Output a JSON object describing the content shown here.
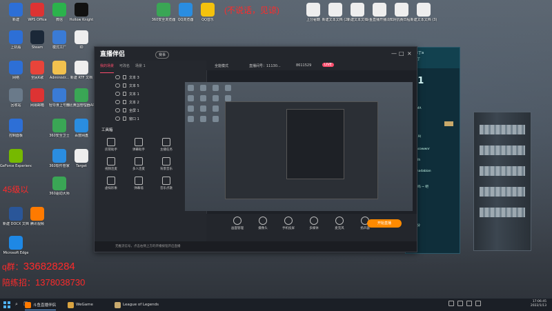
{
  "desktop": {
    "icons": [
      {
        "label": "新建",
        "color": "#2d6fd6"
      },
      {
        "label": "WPS Office",
        "color": "#d33"
      },
      {
        "label": "微信",
        "color": "#2bb24c"
      },
      {
        "label": "Hollow Knight",
        "color": "#111"
      },
      {
        "label": "360安全浏览器",
        "color": "#3aa655"
      },
      {
        "label": "QQ浏览器",
        "color": "#2a8de0"
      },
      {
        "label": "QQ音乐",
        "color": "#f4c20d"
      },
      {
        "label": "上分秘籍",
        "color": "#eeeeee"
      },
      {
        "label": "新建文本文档 (2)",
        "color": "#eeeeee"
      },
      {
        "label": "新建文本文档",
        "color": "#eeeeee"
      },
      {
        "label": "斗鱼直播开播须知",
        "color": "#eeeeee"
      },
      {
        "label": "对抗赛日程",
        "color": "#eeeeee"
      },
      {
        "label": "新建文本文档 (3)",
        "color": "#eeeeee"
      },
      {
        "label": "上机看",
        "color": "#2d6fd6"
      },
      {
        "label": "Steam",
        "color": "#1b2838"
      },
      {
        "label": "模式工厂",
        "color": "#3a7bd5"
      },
      {
        "label": "ID",
        "color": "#eeeeee"
      },
      {
        "label": "网络",
        "color": "#2d6fd6"
      },
      {
        "label": "全民K歌",
        "color": "#e8443a"
      },
      {
        "label": "Administr...",
        "color": "#f2c14e"
      },
      {
        "label": "新建 RTF 文档",
        "color": "#eeeeee"
      },
      {
        "label": "回收站",
        "color": "#6a7a8a"
      },
      {
        "label": "网易邮箱",
        "color": "#d33"
      },
      {
        "label": "轻导身上号器",
        "color": "#3a7bd5"
      },
      {
        "label": "帅比黄国管理器APP",
        "color": "#3aa655"
      },
      {
        "label": "控制面板",
        "color": "#2d6fd6"
      },
      {
        "label": "360安全卫士",
        "color": "#3aa655"
      },
      {
        "label": "百度网盘",
        "color": "#2a8de0"
      },
      {
        "label": "GeForce Experience",
        "color": "#76b900"
      },
      {
        "label": "360软件管家",
        "color": "#2a8de0"
      },
      {
        "label": "Target",
        "color": "#eeeeee"
      },
      {
        "label": "新建 DOCX 文档",
        "color": "#2a5699"
      },
      {
        "label": "腾讯视频",
        "color": "#ff7a00"
      },
      {
        "label": "Microsoft Edge",
        "color": "#1e88e5"
      },
      {
        "label": "360驱动大师",
        "color": "#3aa655"
      }
    ],
    "overlay_red_top": "(不说话，见谅)",
    "overlay_red_left": "45级以",
    "overlay_q_label": "q群：",
    "overlay_q_number": "336828284",
    "overlay_recruit_label": "陪练招：",
    "overlay_recruit_number": "1378038730"
  },
  "obs": {
    "app_name": "直播伴侣",
    "badge": "赛事",
    "tabs": [
      "我的场景",
      "可改名",
      "场景 1"
    ],
    "scenes": [
      "文本 3",
      "文本 5",
      "文本 1",
      "文本 2",
      "全屏 1",
      "窗口 1"
    ],
    "toolbox_title": "工具箱",
    "tools": [
      "房管助手",
      "弹幕助手",
      "主播任务",
      "视频连麦",
      "多人连麦",
      "背景音乐",
      "虚拟形象",
      "弹幕墙",
      "音乐点歌"
    ],
    "top_bar": {
      "mode": "全能模式",
      "room_label": "直播间号：11130...",
      "room_id": "8611529",
      "tag": "LIVE"
    },
    "bottom_tools": [
      "画面管理",
      "摄像头",
      "手机投屏",
      "多媒体",
      "麦克风",
      "扬声器"
    ],
    "live_button": "开始直播",
    "status_bar": "无推流信号，点击右侧上方的开播按钮开启直播"
  },
  "chat": {
    "name": "布丁a",
    "sub": "布丁",
    "time": ":31",
    "lines": [
      "GMA",
      "119)",
      "uncowwnr",
      "ilylh",
      "ichadabian",
      "~ 吗 ~ 吧",
      "哈",
      "下分"
    ]
  },
  "taskbar": {
    "apps": [
      {
        "label": "斗鱼直播伴侣",
        "color": "#ff7a00"
      },
      {
        "label": "WeGame",
        "color": "#d9a441"
      },
      {
        "label": "League of Legends",
        "color": "#c8aa6e"
      }
    ],
    "time": "17:06:45",
    "date": "2022/1/13"
  }
}
